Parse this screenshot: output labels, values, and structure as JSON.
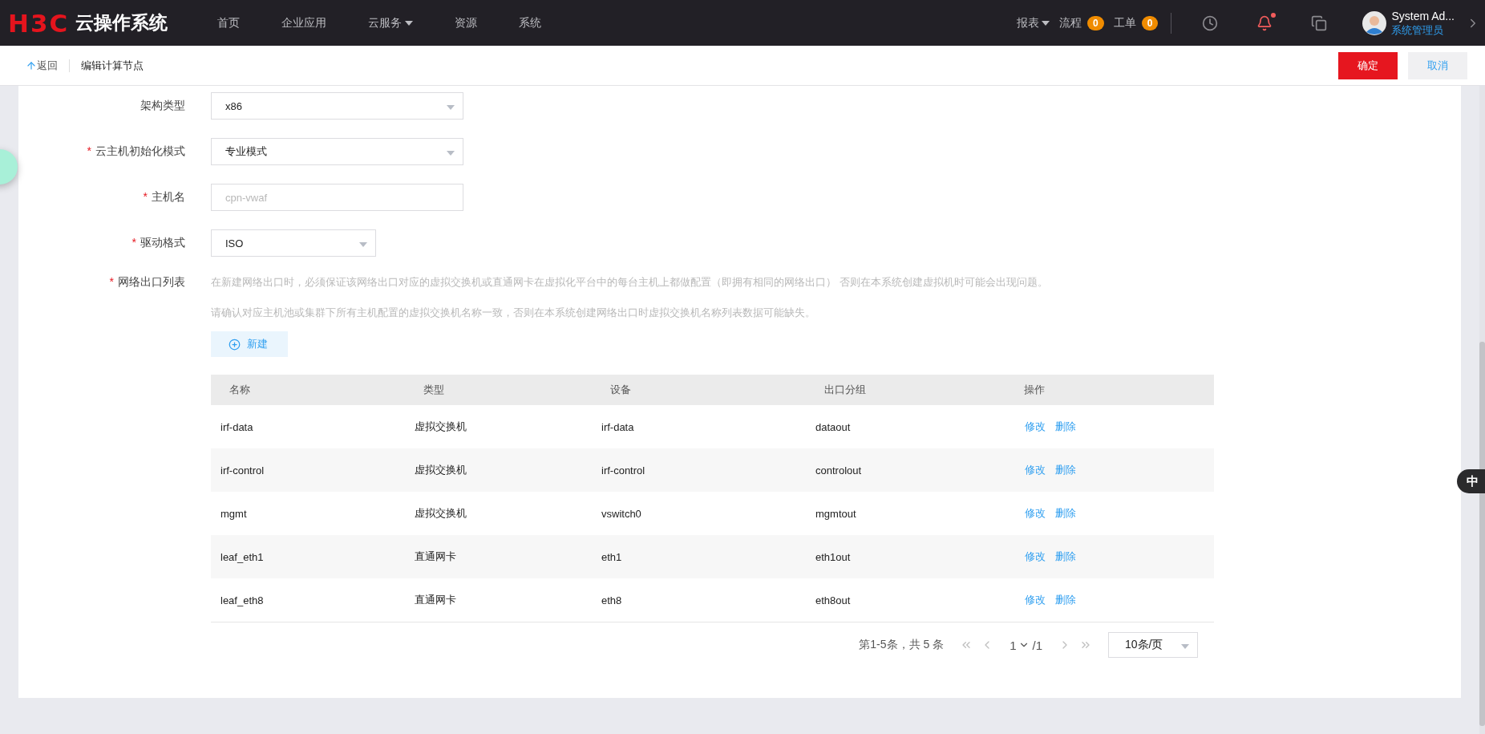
{
  "topbar": {
    "logo_mark": "H3C",
    "logo_text": "云操作系统",
    "nav": [
      {
        "label": "首页",
        "dropdown": false
      },
      {
        "label": "企业应用",
        "dropdown": false
      },
      {
        "label": "云服务",
        "dropdown": true
      },
      {
        "label": "资源",
        "dropdown": false
      },
      {
        "label": "系统",
        "dropdown": false
      }
    ],
    "reports": {
      "label": "报表",
      "dropdown": true
    },
    "counters": [
      {
        "label": "流程",
        "count": "0"
      },
      {
        "label": "工单",
        "count": "0"
      }
    ],
    "notifications_unread": true,
    "user": {
      "name": "System Ad...",
      "role": "系统管理员"
    }
  },
  "subheader": {
    "back": "返回",
    "title": "编辑计算节点",
    "buttons": [
      {
        "label": "确定",
        "kind": "primary"
      },
      {
        "label": "取消",
        "kind": "secondary"
      }
    ]
  },
  "form": {
    "fields": [
      {
        "label": "架构类型",
        "kind": "select",
        "value": "x86"
      },
      {
        "label": "云主机初始化模式",
        "required_mark": "*",
        "kind": "select",
        "value": "专业模式"
      },
      {
        "label": "主机名",
        "required_mark": "*",
        "kind": "text",
        "placeholder": "cpn-vwaf"
      },
      {
        "label": "驱动格式",
        "required_mark": "*",
        "kind": "short-select",
        "value": "ISO"
      }
    ],
    "network": {
      "label": "网络出口列表",
      "required_mark": "*",
      "notes": [
        "在新建网络出口时，必须保证该网络出口对应的虚拟交换机或直通网卡在虚拟化平台中的每台主机上都做配置（即拥有相同的网络出口） 否则在本系统创建虚拟机时可能会出现问题。",
        "请确认对应主机池或集群下所有主机配置的虚拟交换机名称一致，否则在本系统创建网络出口时虚拟交换机名称列表数据可能缺失。"
      ],
      "new_button": "新建",
      "table": {
        "columns": [
          "名称",
          "类型",
          "设备",
          "出口分组",
          "操作"
        ],
        "rows": [
          {
            "cells": [
              "irf-data",
              "虚拟交换机",
              "irf-data",
              "dataout"
            ],
            "actions": [
              "修改",
              "删除"
            ]
          },
          {
            "cells": [
              "irf-control",
              "虚拟交换机",
              "irf-control",
              "controlout"
            ],
            "actions": [
              "修改",
              "删除"
            ]
          },
          {
            "cells": [
              "mgmt",
              "虚拟交换机",
              "vswitch0",
              "mgmtout"
            ],
            "actions": [
              "修改",
              "删除"
            ]
          },
          {
            "cells": [
              "leaf_eth1",
              "直通网卡",
              "eth1",
              "eth1out"
            ],
            "actions": [
              "修改",
              "删除"
            ]
          },
          {
            "cells": [
              "leaf_eth8",
              "直通网卡",
              "eth8",
              "eth8out"
            ],
            "actions": [
              "修改",
              "删除"
            ]
          }
        ]
      },
      "pagination": {
        "summary": "第1-5条，共 5 条",
        "page": "1",
        "total": "/1",
        "page_size": "10条/页"
      }
    }
  },
  "ime_badge": "中"
}
